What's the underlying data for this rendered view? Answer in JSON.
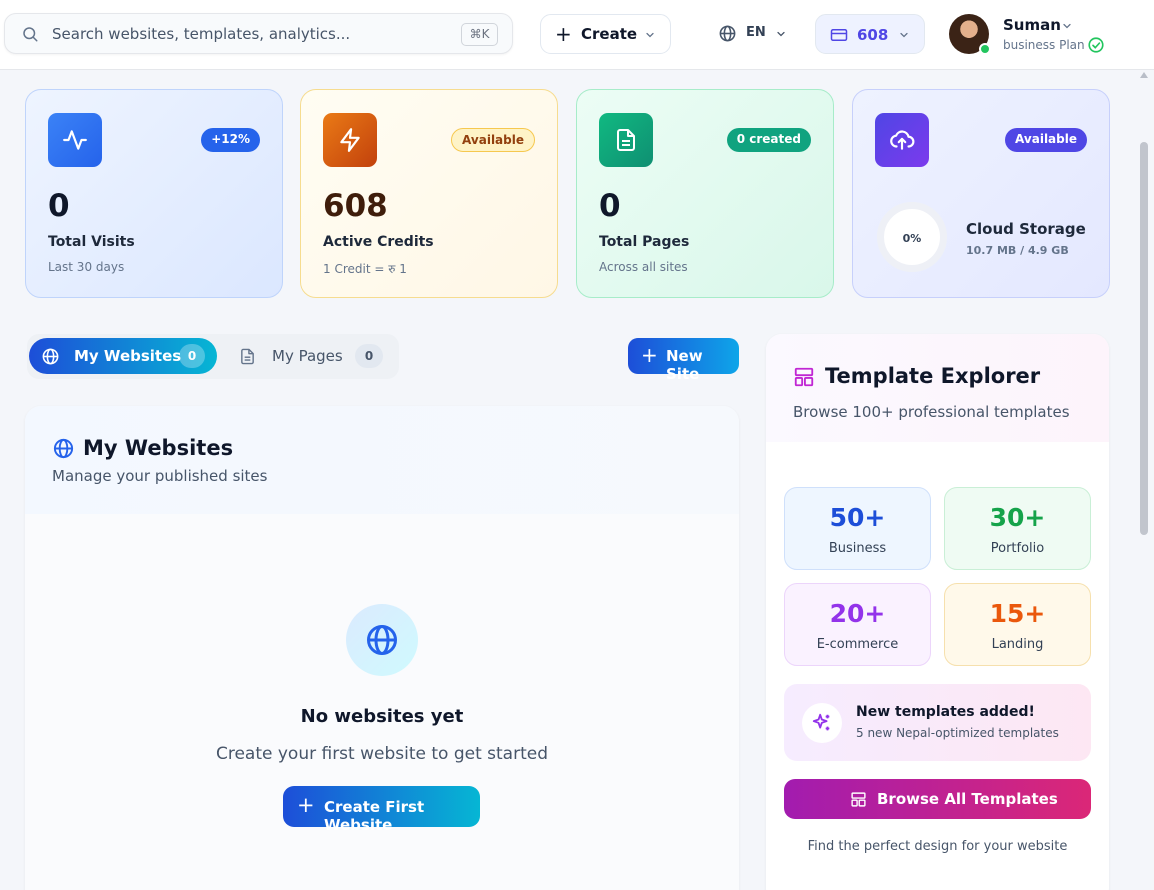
{
  "search": {
    "placeholder": "Search websites, templates, analytics...",
    "shortcut": "⌘K",
    "icon": "search-icon"
  },
  "header": {
    "create_label": "Create",
    "language": "EN",
    "credits": "608",
    "user": {
      "name": "Suman",
      "plan": "business Plan",
      "status": "online"
    }
  },
  "stats": [
    {
      "icon": "activity-icon",
      "badge": "+12%",
      "value": "0",
      "label": "Total Visits",
      "sub": "Last 30 days",
      "color": "#2563eb"
    },
    {
      "icon": "lightning-icon",
      "badge": "Available",
      "value": "608",
      "label": "Active Credits",
      "sub": "1 Credit = रु 1",
      "color": "#ea7a16"
    },
    {
      "icon": "document-icon",
      "badge": "0 created",
      "value": "0",
      "label": "Total Pages",
      "sub": "Across all sites",
      "color": "#10b981"
    },
    {
      "icon": "cloud-upload-icon",
      "badge": "Available",
      "percent": "0%",
      "label": "Cloud Storage",
      "sub": "10.7 MB / 4.9 GB",
      "color": "#4f46e5"
    }
  ],
  "tabs": [
    {
      "label": "My Websites",
      "count": "0",
      "active": true
    },
    {
      "label": "My Pages",
      "count": "0",
      "active": false
    }
  ],
  "new_site_label": "New Site",
  "websites_panel": {
    "title": "My Websites",
    "subtitle": "Manage your published sites",
    "empty_title": "No websites yet",
    "empty_sub": "Create your first website to get started",
    "cta": "Create First Website"
  },
  "template_explorer": {
    "title": "Template Explorer",
    "subtitle": "Browse 100+ professional templates",
    "categories": [
      {
        "count": "50+",
        "label": "Business",
        "color": "#1d4ed8"
      },
      {
        "count": "30+",
        "label": "Portfolio",
        "color": "#15a34a"
      },
      {
        "count": "20+",
        "label": "E-commerce",
        "color": "#9333ea"
      },
      {
        "count": "15+",
        "label": "Landing",
        "color": "#ea580c"
      }
    ],
    "promo_title": "New templates added!",
    "promo_sub": "5 new Nepal-optimized templates",
    "browse_label": "Browse All Templates",
    "footer": "Find the perfect design for your website"
  }
}
